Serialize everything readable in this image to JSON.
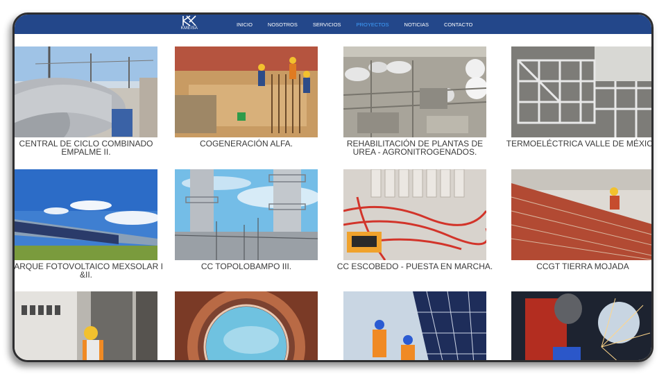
{
  "brand": {
    "logo_text": "KMEISA"
  },
  "nav": {
    "items": [
      {
        "label": "INICIO",
        "active": false
      },
      {
        "label": "NOSOTROS",
        "active": false
      },
      {
        "label": "SERVICIOS",
        "active": false
      },
      {
        "label": "PROYECTOS",
        "active": true
      },
      {
        "label": "NOTICIAS",
        "active": false
      },
      {
        "label": "CONTACTO",
        "active": false
      }
    ]
  },
  "colors": {
    "navbar": "#23478a",
    "active_link": "#3fa0ff",
    "caption": "#3a3a3a"
  },
  "projects": [
    {
      "title": "CENTRAL DE CICLO COMBINADO EMPALME II.",
      "image": "power-plant-pipes-image"
    },
    {
      "title": "COGENERACIÓN ALFA.",
      "image": "construction-rebar-image"
    },
    {
      "title": "REHABILITACIÓN DE PLANTAS DE UREA - AGRONITROGENADOS.",
      "image": "industrial-plant-aerial-image"
    },
    {
      "title": "TERMOELÉCTRICA VALLE DE MÉXICO",
      "image": "steel-structure-image"
    },
    {
      "title": "PARQUE FOTOVOLTAICO MEXSOLAR I &II.",
      "image": "solar-park-image"
    },
    {
      "title": "CC TOPOLOBAMPO III.",
      "image": "chimney-stacks-image"
    },
    {
      "title": "CC ESCOBEDO - PUESTA EN MARCHA.",
      "image": "electrical-panel-image"
    },
    {
      "title": "CCGT TIERRA MOJADA",
      "image": "brick-wall-worker-image"
    },
    {
      "title": "",
      "image": "electrician-panel-image"
    },
    {
      "title": "",
      "image": "pipe-interior-image"
    },
    {
      "title": "",
      "image": "solar-panel-workers-image"
    },
    {
      "title": "",
      "image": "welder-sparks-image"
    }
  ]
}
